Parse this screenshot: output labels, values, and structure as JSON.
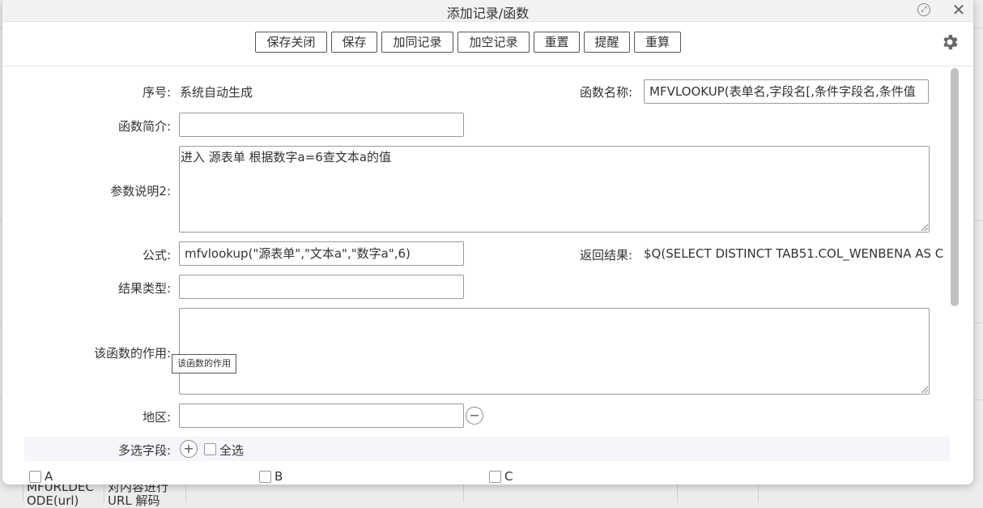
{
  "dialog": {
    "title": "添加记录/函数"
  },
  "toolbar": {
    "buttons": [
      "保存关闭",
      "保存",
      "加同记录",
      "加空记录",
      "重置",
      "提醒",
      "重算"
    ]
  },
  "form": {
    "seq_label": "序号:",
    "seq_value": "系统自动生成",
    "func_name_label": "函数名称:",
    "func_name_value": "MFVLOOKUP(表单名,字段名[,条件字段名,条件值",
    "intro_label": "函数简介:",
    "intro_value": "",
    "param_label": "参数说明2:",
    "param_value": "进入 源表单 根据数字a=6查文本a的值",
    "formula_label": "公式:",
    "formula_value": "mfvlookup(\"源表单\",\"文本a\",\"数字a\",6)",
    "result_label": "返回结果:",
    "result_value": "$Q(SELECT DISTINCT TAB51.COL_WENBENA AS C",
    "result_type_label": "结果类型:",
    "result_type_value": "",
    "purpose_label": "该函数的作用:",
    "purpose_value": "",
    "purpose_tooltip": "该函数的作用",
    "region_label": "地区:",
    "region_value": "",
    "multi_label": "多选字段:",
    "select_all_label": "全选",
    "options": [
      "A",
      "B",
      "C"
    ]
  },
  "background": {
    "cells": [
      "MFURLDEC",
      "ODE(url)",
      "对内容进行",
      "URL 解码"
    ]
  }
}
